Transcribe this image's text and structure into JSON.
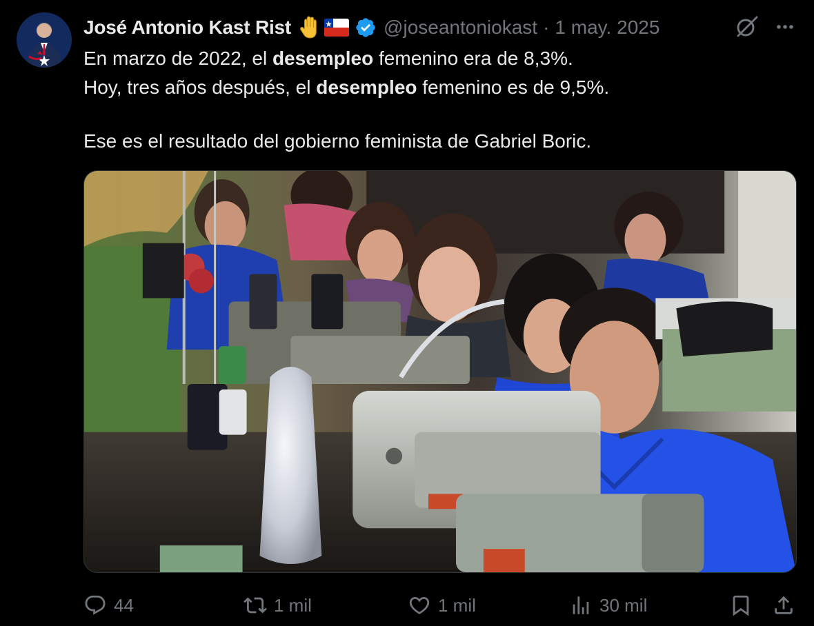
{
  "author": {
    "display_name": "José Antonio Kast Rist",
    "emoji": "🖐️",
    "handle": "@joseantoniokast",
    "separator": "·",
    "date": "1 may. 2025"
  },
  "icons": {
    "verified": "verified-badge-icon",
    "grok": "grok-icon",
    "more": "more-options-icon",
    "reply": "reply-icon",
    "retweet": "retweet-icon",
    "like": "heart-icon",
    "views": "views-icon",
    "bookmark": "bookmark-icon",
    "share": "share-icon"
  },
  "text": {
    "line1_pre": "En marzo de 2022, el ",
    "line1_bold": "desempleo",
    "line1_post": " femenino era de 8,3%.",
    "line2_pre": "Hoy, tres años después, el ",
    "line2_bold": "desempleo",
    "line2_post": " femenino es de 9,5%.",
    "line3": "Ese es el resultado del gobierno feminista de Gabriel Boric."
  },
  "stats": {
    "replies": "44",
    "retweets": "1 mil",
    "likes": "1 mil",
    "views": "30 mil"
  },
  "colors": {
    "background": "#000000",
    "text": "#e7e9ea",
    "muted": "#71767b",
    "verified": "#1d9bf0",
    "border": "#2f3336"
  }
}
